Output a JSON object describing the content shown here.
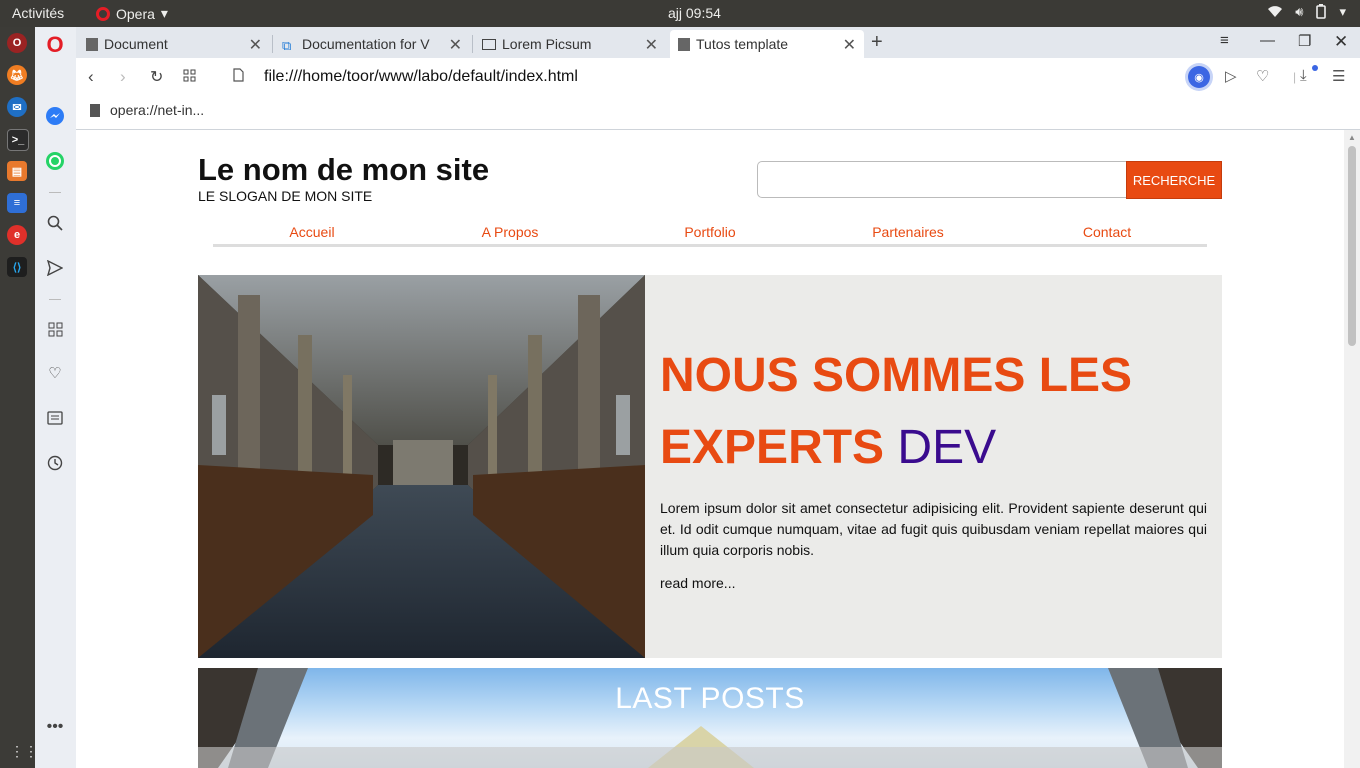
{
  "topbar": {
    "activities": "Activités",
    "app_name": "Opera",
    "clock": "ajj 09:54"
  },
  "tabs": [
    {
      "label": "Document"
    },
    {
      "label": "Documentation for V"
    },
    {
      "label": "Lorem Picsum"
    },
    {
      "label": "Tutos template"
    }
  ],
  "address": {
    "url": "file:///home/toor/www/labo/default/index.html"
  },
  "bookmarks": {
    "item": "opera://net-in..."
  },
  "site": {
    "title": "Le nom de mon site",
    "slogan": "LE SLOGAN DE MON SITE",
    "search_button": "RECHERCHE",
    "search_value": "",
    "nav": [
      "Accueil",
      "A Propos",
      "Portfolio",
      "Partenaires",
      "Contact"
    ],
    "hero": {
      "title_line1": "NOUS SOMMES LES",
      "title_line2_bold": "EXPERTS",
      "title_line2_light": "DEV",
      "text": "Lorem ipsum dolor sit amet consectetur adipisicing elit. Provident sapiente deserunt qui et. Id odit cumque numquam, vitae ad fugit quis quibusdam veniam repellat maiores qui illum quia corporis nobis.",
      "link": "read more..."
    },
    "posts_title": "LAST POSTS"
  },
  "colors": {
    "accent": "#e84a12",
    "dev_purple": "#3a0b8e",
    "hero_bg": "#ebebe9"
  }
}
